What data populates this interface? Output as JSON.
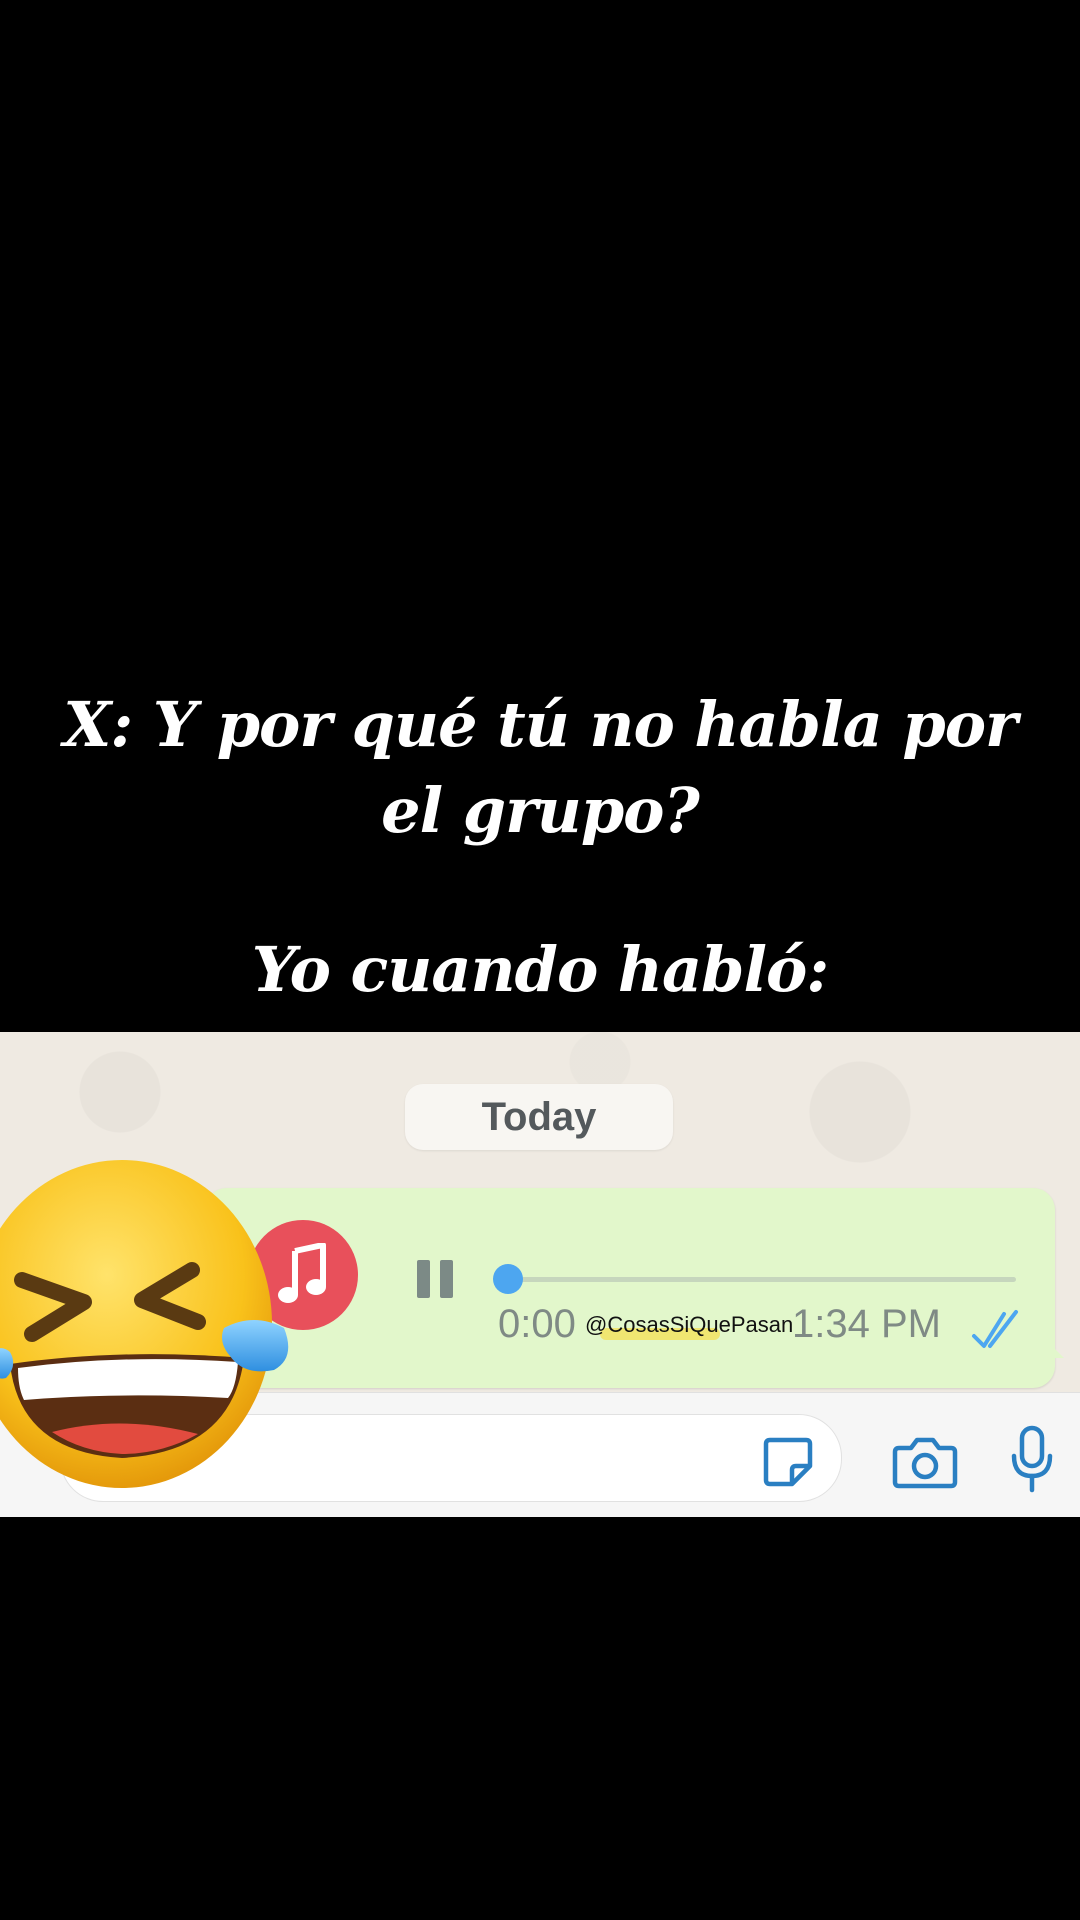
{
  "caption": {
    "question_line1": "X: Y por qué tú no habla por",
    "question_line2": "el grupo?",
    "answer": "Yo cuando habló:"
  },
  "chat": {
    "date_label": "Today",
    "voice_message": {
      "duration": "0:00",
      "time": "1:34 PM",
      "progress": 0.0,
      "avatar_icon": "music-note-icon",
      "status_icon": "double-check-icon",
      "status": "read"
    },
    "watermark": "@CosasSiQuePasan",
    "input_bar": {
      "icons": [
        "sticker-icon",
        "camera-icon",
        "microphone-icon"
      ]
    }
  },
  "overlay": {
    "emoji_icon": "grinning-squinting-tears-of-joy-emoji"
  },
  "colors": {
    "background": "#000000",
    "chat_background": "#efeae2",
    "bubble": "#e2f7cb",
    "accent_blue": "#4da6f0",
    "avatar_red": "#e8505b",
    "icon_blue": "#2a7fc2"
  }
}
